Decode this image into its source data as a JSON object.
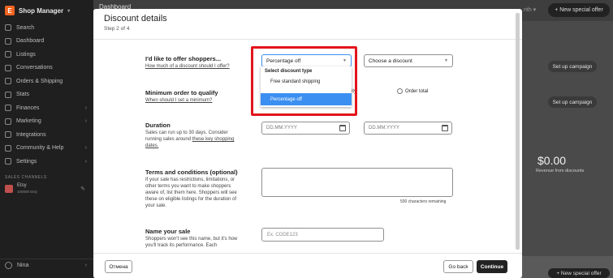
{
  "sidebar": {
    "app_title": "Shop Manager",
    "title_chevron": "▾",
    "items": [
      {
        "label": "Search"
      },
      {
        "label": "Dashboard"
      },
      {
        "label": "Listings"
      },
      {
        "label": "Conversations"
      },
      {
        "label": "Orders & Shipping"
      },
      {
        "label": "Stats"
      },
      {
        "label": "Finances",
        "chevron": "›"
      },
      {
        "label": "Marketing",
        "chevron": "›"
      },
      {
        "label": "Integrations"
      },
      {
        "label": "Community & Help",
        "chevron": "›"
      },
      {
        "label": "Settings",
        "chevron": "›"
      }
    ],
    "section_label": "SALES CHANNELS",
    "shop": {
      "name": "Etsy",
      "sub": "100000 Etsy"
    },
    "bottom_label": "Nina",
    "bottom_chevron": "›"
  },
  "background": {
    "header": "Dashboard",
    "month": "nth ▾",
    "new_offer": "+ New special offer",
    "setup_campaign_1": "Set up campaign",
    "setup_campaign_2": "Set up campaign",
    "amount": "$0.00",
    "revenue_label": "Revenue from discounts",
    "bottom_offer": "+ New special offer"
  },
  "modal": {
    "title": "Discount details",
    "step": "Step 2 of 4",
    "offer": {
      "title": "I'd like to offer shoppers...",
      "help": "How much of a discount should I offer?",
      "type_value": "Percentage off",
      "discount_placeholder": "Choose a discount",
      "dropdown": {
        "header": "Select discount type",
        "options": [
          "Free standard shipping",
          "Percentage off"
        ]
      }
    },
    "minimum": {
      "title": "Minimum order to qualify",
      "help": "When should I set a minimum?",
      "hidden_option_tail": "ity",
      "order_total": "Order total"
    },
    "duration": {
      "title": "Duration",
      "help_prefix": "Sales can run up to 30 days. Consider running sales around",
      "help_link": "these key shopping dates.",
      "start_placeholder": "DD.MM.YYYY",
      "end_placeholder": "DD.MM.YYYY"
    },
    "terms": {
      "title": "Terms and conditions (optional)",
      "help": "If your sale has restrictions, limitations, or other terms you want to make shoppers aware of, list them here. Shoppers will see these on eligible listings for the duration of your sale.",
      "chars_remaining": "500 characters remaining"
    },
    "name": {
      "title": "Name your sale",
      "help": "Shoppers won't see this name, but it's how you'll track its performance. Each",
      "placeholder": "Ex. CODE123"
    },
    "footer": {
      "cancel": "Отмена",
      "back": "Go back",
      "continue": "Continue"
    }
  }
}
